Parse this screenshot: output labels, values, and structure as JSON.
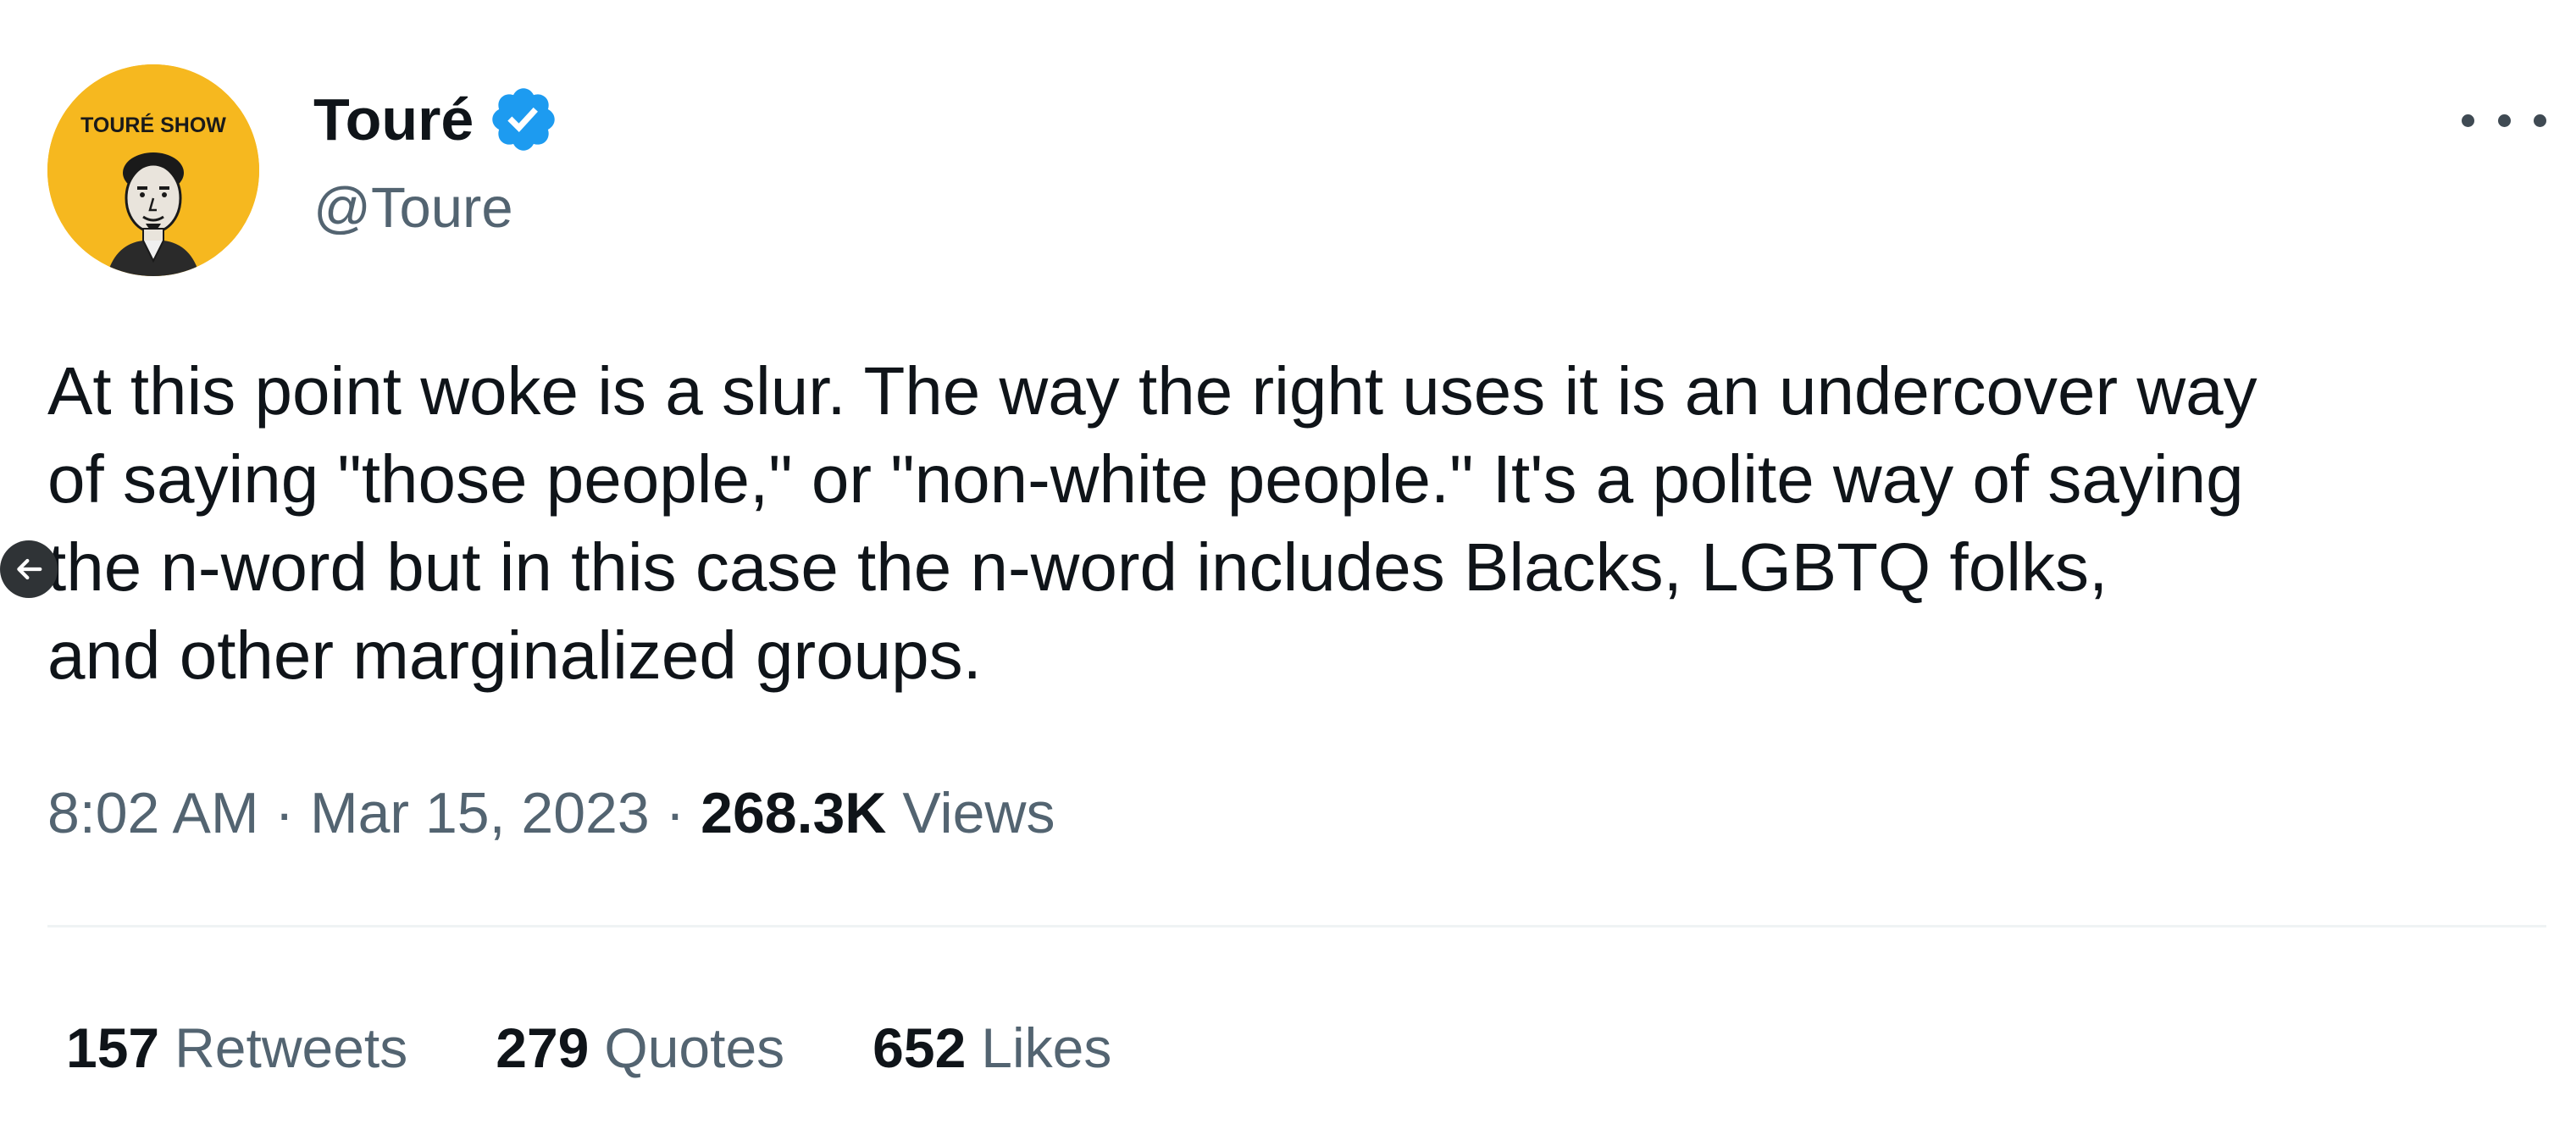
{
  "tweet": {
    "author": {
      "display_name": "Touré",
      "handle": "@Toure",
      "verified": true,
      "avatar_caption": "TOURÉ SHOW",
      "avatar_bg_color": "#f6b81f"
    },
    "body_lines": [
      "At this point woke is a slur. The way the right uses it is an undercover way",
      "of saying \"those people,\" or \"non-white people.\" It's a polite way of saying",
      "the n-word but in this case the n-word includes Blacks, LGBTQ folks,",
      "and other marginalized groups."
    ],
    "time": "8:02 AM",
    "separator": "·",
    "date": "Mar 15, 2023",
    "views_count": "268.3K",
    "views_label": "Views",
    "stats": [
      {
        "count": "157",
        "label": "Retweets"
      },
      {
        "count": "279",
        "label": "Quotes"
      },
      {
        "count": "652",
        "label": "Likes"
      }
    ]
  },
  "icons": {
    "verified": "verified-badge-icon",
    "more": "more-options-icon",
    "back": "back-arrow-icon"
  },
  "colors": {
    "verified_blue": "#1d9bf0",
    "text_primary": "#0f1419",
    "text_secondary": "#536471",
    "divider": "#eff3f4"
  }
}
